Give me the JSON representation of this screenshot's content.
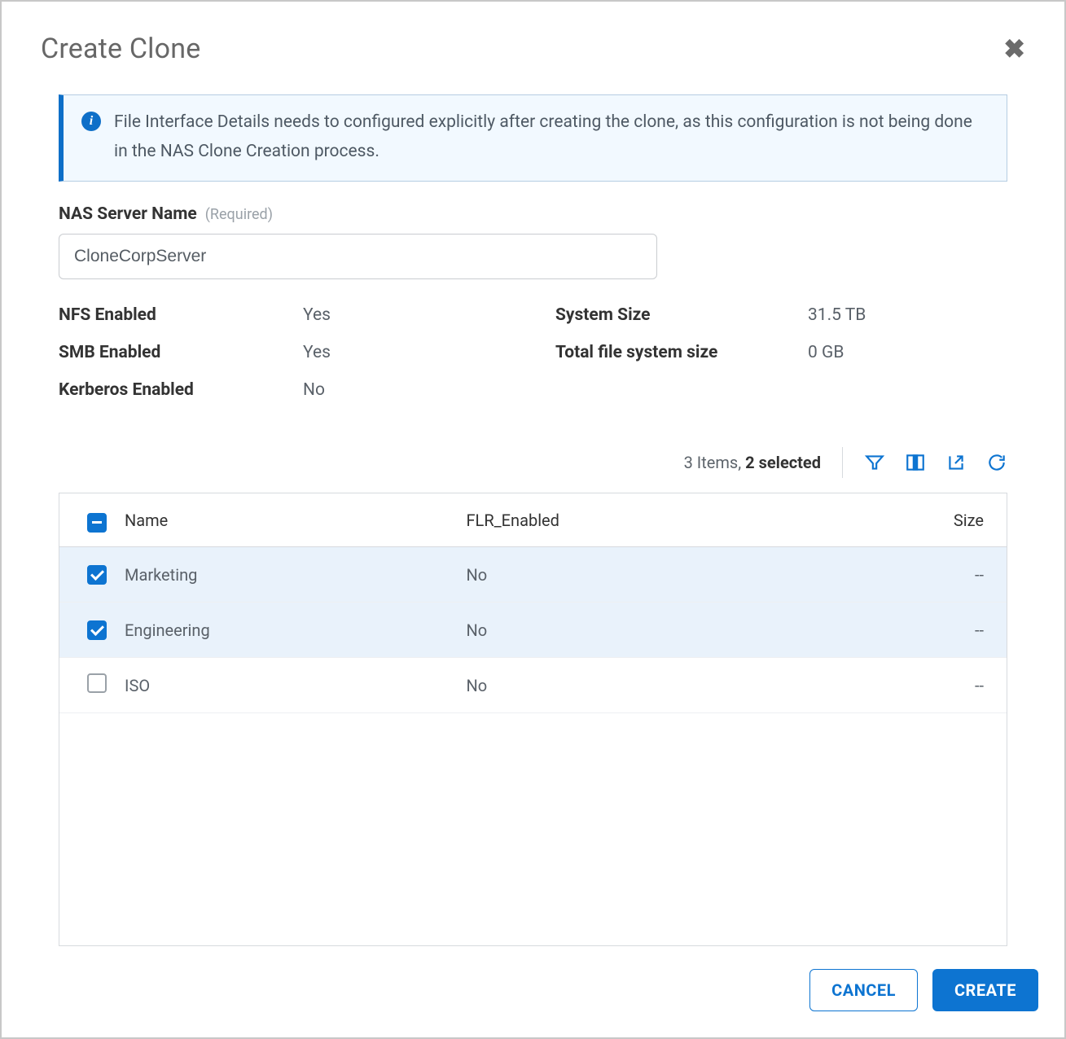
{
  "modal": {
    "title": "Create Clone"
  },
  "banner": {
    "text": "File Interface Details needs to configured explicitly after creating the clone, as this configuration is not being done in the NAS Clone Creation process."
  },
  "name_field": {
    "label": "NAS Server Name",
    "required_hint": "(Required)",
    "value": "CloneCorpServer"
  },
  "props": {
    "nfs_label": "NFS Enabled",
    "nfs_value": "Yes",
    "smb_label": "SMB Enabled",
    "smb_value": "Yes",
    "kerberos_label": "Kerberos Enabled",
    "kerberos_value": "No",
    "system_size_label": "System Size",
    "system_size_value": "31.5 TB",
    "total_fs_label": "Total file system size",
    "total_fs_value": "0 GB"
  },
  "table": {
    "items_count": "3 Items",
    "selected_text": "2 selected",
    "columns": {
      "name": "Name",
      "flr": "FLR_Enabled",
      "size": "Size"
    },
    "rows": [
      {
        "name": "Marketing",
        "flr": "No",
        "size": "--",
        "checked": true
      },
      {
        "name": "Engineering",
        "flr": "No",
        "size": "--",
        "checked": true
      },
      {
        "name": "ISO",
        "flr": "No",
        "size": "--",
        "checked": false
      }
    ]
  },
  "footer": {
    "cancel": "CANCEL",
    "create": "CREATE"
  },
  "icons": {
    "filter": "filter-icon",
    "columns": "columns-icon",
    "export": "export-icon",
    "refresh": "refresh-icon"
  }
}
